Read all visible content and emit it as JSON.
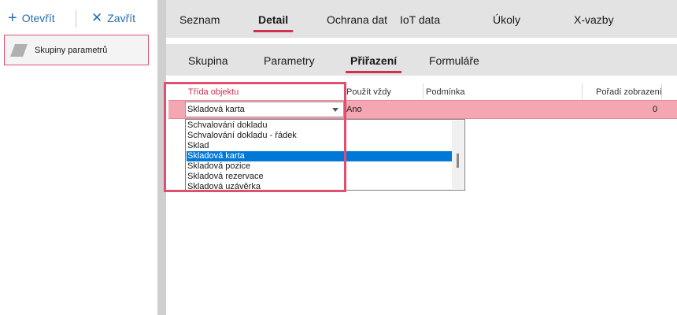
{
  "toolbar": {
    "open_label": "Otevřít",
    "close_label": "Zavřít",
    "open_glyph": "+",
    "close_glyph": "✕"
  },
  "sidebar": {
    "items": [
      {
        "label": "Skupiny parametrů"
      }
    ]
  },
  "top_tabs": [
    {
      "label": "Seznam"
    },
    {
      "label": "Detail",
      "active": true
    },
    {
      "label": "Ochrana dat"
    },
    {
      "label": "IoT data"
    },
    {
      "label": "Úkoly"
    },
    {
      "label": "X-vazby"
    }
  ],
  "sub_tabs": [
    {
      "label": "Skupina"
    },
    {
      "label": "Parametry"
    },
    {
      "label": "Přiřazení",
      "active": true
    },
    {
      "label": "Formuláře"
    }
  ],
  "grid": {
    "headers": {
      "trida": "Třída objektu",
      "pouzit": "Použít vždy",
      "podminka": "Podmínka",
      "poradi": "Pořadí zobrazení"
    },
    "row": {
      "trida": "Skladová karta",
      "pouzit": "Ano",
      "podminka": "",
      "poradi": "0"
    }
  },
  "dropdown": {
    "options": [
      "Schvalování dokladu",
      "Schvalování dokladu - řádek",
      "Sklad",
      "Skladová karta",
      "Skladová pozice",
      "Skladová rezervace",
      "Skladová uzávěrka"
    ],
    "selected_index": 3
  },
  "colors": {
    "accent": "#d03050",
    "highlight_border": "#e0506e",
    "selected_row": "#f4a6b3",
    "selected_option": "#0078d7",
    "link_blue": "#2c6fb0"
  }
}
